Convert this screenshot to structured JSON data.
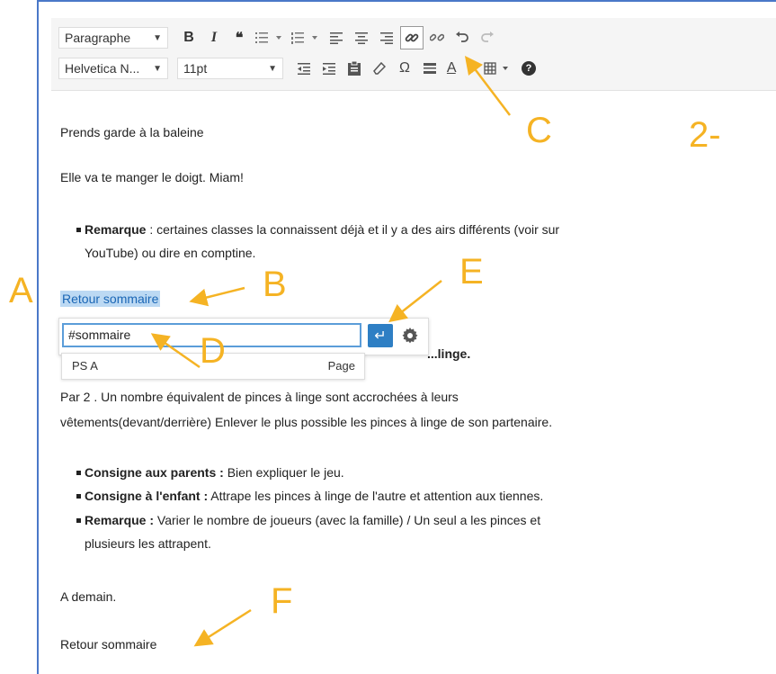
{
  "toolbar": {
    "row1": {
      "format_select": "Paragraphe",
      "buttons": [
        "bold",
        "italic",
        "blockquote",
        "bullet-list",
        "numbered-list",
        "align-left",
        "align-center",
        "align-right",
        "insert-link",
        "remove-link",
        "undo",
        "redo"
      ],
      "bold_label": "B",
      "italic_label": "I",
      "quote_label": "❝"
    },
    "row2": {
      "font_select": "Helvetica N...",
      "size_select": "11pt",
      "omega_label": "Ω",
      "text_color_label": "A",
      "help_label": "?"
    }
  },
  "content": {
    "p1": "Prends garde à la baleine",
    "p2": "Elle va te manger le doigt. Miam!",
    "b1_strong": "Remarque",
    "b1_text": " : certaines classes la connaissent déjà et il y a des airs différents (voir sur",
    "b1_cont": "YouTube) ou dire en comptine.",
    "link_selected": "Retour sommaire",
    "p3": "Par 2 . Un nombre équivalent de pinces à linge sont accrochées à leurs",
    "p3_cont": "vêtements(devant/derrière) Enlever le plus possible les pinces à linge de son partenaire.",
    "b2_strong": "Consigne aux parents :",
    "b2_text": " Bien expliquer le jeu.",
    "b3_strong": "Consigne à l'enfant :",
    "b3_text": " Attrape les pinces à linge de l'autre et attention aux tiennes.",
    "b4_strong": "Remarque :",
    "b4_text": " Varier le nombre de joueurs (avec la famille) / Un seul a les pinces et",
    "b4_cont": "plusieurs les attrapent.",
    "p4": "A demain.",
    "p5": "Retour sommaire",
    "hidden_fragment": "...linge."
  },
  "link_popup": {
    "input_value": "#sommaire",
    "apply_icon": "↵",
    "suggestion_title": "PS A",
    "suggestion_type": "Page"
  },
  "annotations": {
    "A": "A",
    "B": "B",
    "C": "C",
    "D": "D",
    "E": "E",
    "F": "F",
    "step": "2-",
    "color": "#f5b324"
  }
}
